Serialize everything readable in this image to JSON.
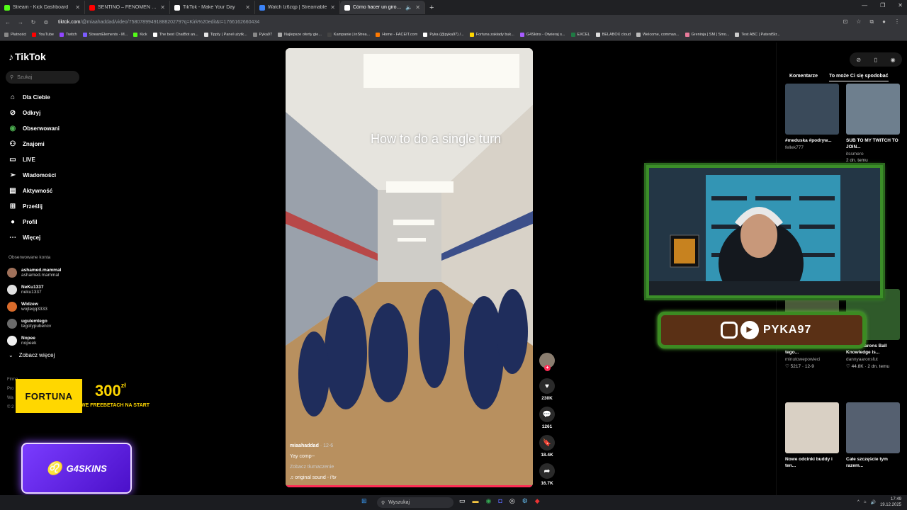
{
  "browser": {
    "tabs": [
      {
        "label": "Stream - Kick Dashboard",
        "color": "#53fc18"
      },
      {
        "label": "SENTINO – FENOMEN prod. M",
        "color": "#ff0000"
      },
      {
        "label": "TikTok - Make Your Day",
        "color": "#ffffff"
      },
      {
        "label": "Watch lz6zqp | Streamable",
        "color": "#3b82f6"
      },
      {
        "label": "Cómo hacer un giro en el t",
        "color": "#ffffff"
      }
    ],
    "url_host": "tiktok.com",
    "url_path": "/@miaahaddad/video/7580789949188820279?q=Kirk%20edit&t=1766162660434",
    "bookmarks": [
      "Płatności",
      "YouTube",
      "Twitch",
      "StreamElements - M...",
      "Kick",
      "The best ChatBot an...",
      "Tipply | Panel użytk...",
      "Pyka97",
      "Najlepsze oferty gie...",
      "Kampanie | inStrea...",
      "Home - FACEIT.com",
      "Pyka (@pyka97) /...",
      "Fortuna zakłady buk...",
      "G4Skins - Otwieraj s...",
      "EXCEL",
      "BELABOX cloud",
      "Welcome, comman...",
      "Greninja | SM | Smo...",
      "Test ABC | PatentStr..."
    ]
  },
  "tiktok": {
    "logo": "TikTok",
    "search_placeholder": "Szukaj",
    "menu": [
      {
        "label": "Dla Ciebie",
        "icon": "home-icon"
      },
      {
        "label": "Odkryj",
        "icon": "compass-icon"
      },
      {
        "label": "Obserwowani",
        "icon": "following-icon"
      },
      {
        "label": "Znajomi",
        "icon": "friends-icon"
      },
      {
        "label": "LIVE",
        "icon": "live-icon"
      },
      {
        "label": "Wiadomości",
        "icon": "messages-icon"
      },
      {
        "label": "Aktywność",
        "icon": "activity-icon"
      },
      {
        "label": "Prześlij",
        "icon": "upload-icon"
      },
      {
        "label": "Profil",
        "icon": "profile-icon"
      },
      {
        "label": "Więcej",
        "icon": "more-icon"
      }
    ],
    "following_header": "Obserwowane konta",
    "following": [
      {
        "name": "ashamed.mammal",
        "handle": "ashamed.mammal",
        "color": "#a0715a"
      },
      {
        "name": "NeKu1337",
        "handle": "neku1337",
        "color": "#e0e0e0"
      },
      {
        "name": "Widzew",
        "handle": "wojteqq3333",
        "color": "#d96b2b"
      },
      {
        "name": "ugulemtego",
        "handle": "tegotypubencv",
        "color": "#6b6b6b"
      },
      {
        "name": "Nopee",
        "handle": "nopeek",
        "color": "#f0f0f0"
      }
    ],
    "see_more": "Zobacz więcej",
    "footer": [
      "Firma",
      "Pro",
      "Wa",
      "© 2"
    ],
    "video": {
      "caption_overlay": "How to do a single turn",
      "user": "miaahaddad",
      "date": "· 12-6",
      "description": "Yay comp--",
      "translate": "Zobacz tłumaczenie",
      "sound": "♫ original sound - i’tv"
    },
    "actions": {
      "likes": "230K",
      "comments": "1261",
      "saves": "18.4K",
      "shares": "16.7K"
    },
    "right_tabs": [
      "Komentarze",
      "To może Ci się spodobać"
    ],
    "cards": [
      {
        "title": "#meduska #podryw...",
        "author": "fellek777",
        "stats": "",
        "color": "#3a4a5a"
      },
      {
        "title": "SUB TO MY TWITCH TO JOIN...",
        "author": "itssmero",
        "stats": "2 dn. temu",
        "color": "#6e7f8e"
      },
      {
        "title": "Co sądzisz o zachowaniu tego...",
        "author": "minutowepowieci",
        "stats": "♡ 5217 · 12-9",
        "color": "#4a5a3a"
      },
      {
        "title": "Danny Aarons Ball Knowledge is...",
        "author": "dannyaaronsfut",
        "stats": "♡ 44.8K · 2 dn. temu",
        "color": "#2f5a2a"
      },
      {
        "title": "Nowe odcinki buddy i ten...",
        "author": "",
        "stats": "",
        "color": "#d9d0c4"
      },
      {
        "title": "Całe szczęście tym razem...",
        "author": "",
        "stats": "",
        "color": "#556070"
      }
    ]
  },
  "overlay": {
    "fortuna_logo": "FORTUNA",
    "fortuna_amount": "300",
    "fortuna_currency": "zł",
    "fortuna_sub": "WE FREEBETACH NA START",
    "g4skins": "G4SKINS",
    "handle": "PYKA97"
  },
  "taskbar": {
    "search": "Wyszukaj",
    "time": "17:49",
    "date": "19.12.2025"
  }
}
